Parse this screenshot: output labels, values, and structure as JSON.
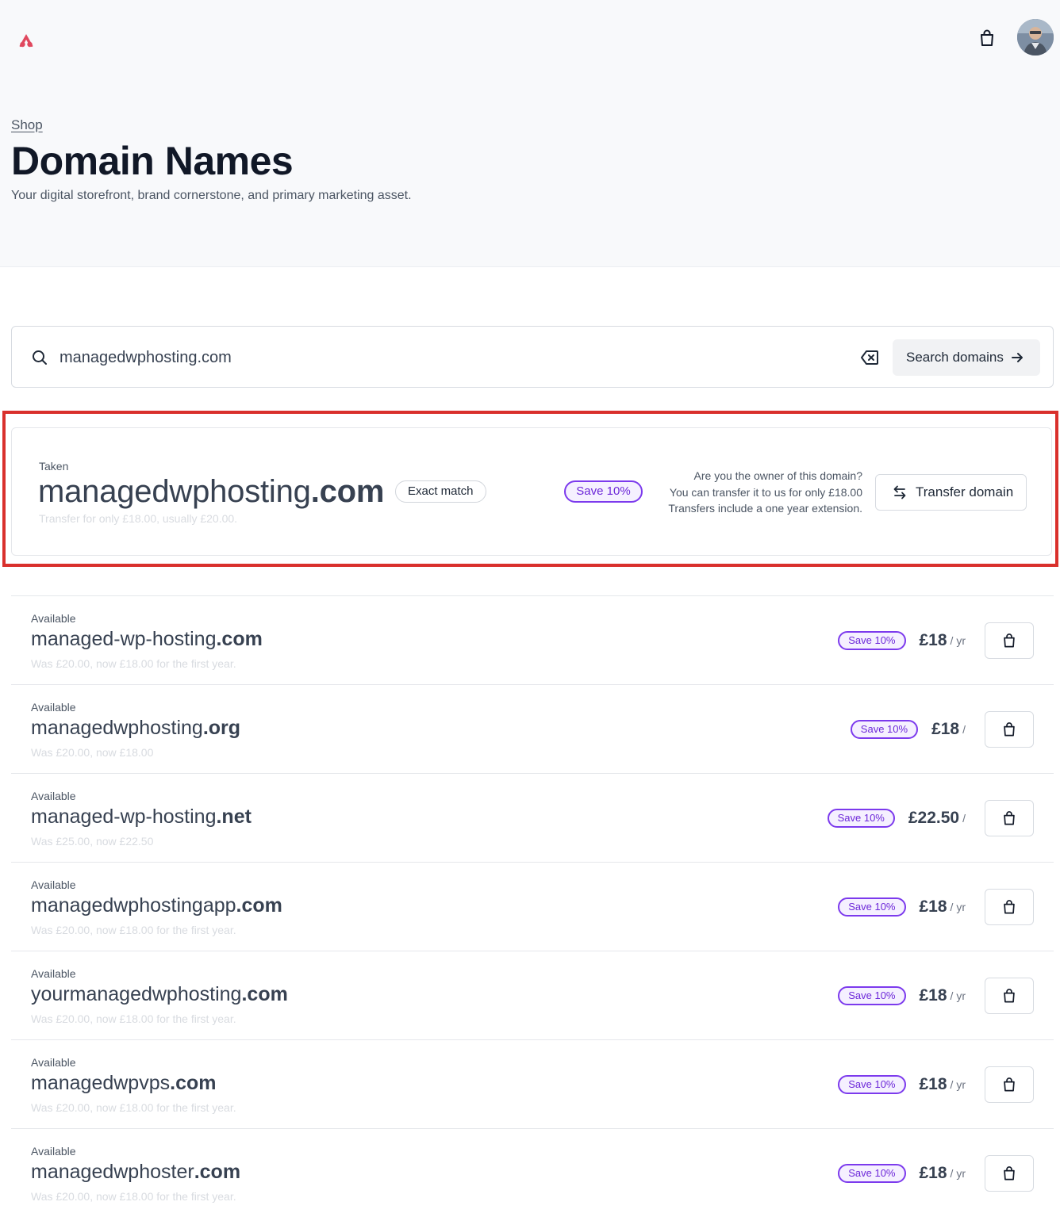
{
  "header": {
    "logo_icon": "brand-logo-icon",
    "cart_icon": "shopping-bag-icon",
    "avatar_alt": "user-avatar"
  },
  "page": {
    "breadcrumb": "Shop",
    "title": "Domain Names",
    "subtitle": "Your digital storefront, brand cornerstone, and primary marketing asset."
  },
  "search": {
    "value": "managedwphosting.com",
    "button_label": "Search domains"
  },
  "exact": {
    "status": "Taken",
    "name": "managedwphosting",
    "tld": ".com",
    "match_badge": "Exact match",
    "note": "Transfer for only £18.00, usually £20.00.",
    "save_badge": "Save 10%",
    "info_line1": "Are you the owner of this domain?",
    "info_line2": "You can transfer it to us for only £18.00",
    "info_line3": "Transfers include a one year extension.",
    "transfer_button": "Transfer domain"
  },
  "results": [
    {
      "status": "Available",
      "name": "managed-wp-hosting",
      "tld": ".com",
      "note": "Was £20.00, now £18.00 for the first year.",
      "save": "Save 10%",
      "price": "£18",
      "per": "/ yr"
    },
    {
      "status": "Available",
      "name": "managedwphosting",
      "tld": ".org",
      "note": "Was £20.00, now £18.00",
      "save": "Save 10%",
      "price": "£18",
      "per": "/"
    },
    {
      "status": "Available",
      "name": "managed-wp-hosting",
      "tld": ".net",
      "note": "Was £25.00, now £22.50",
      "save": "Save 10%",
      "price": "£22.50",
      "per": "/"
    },
    {
      "status": "Available",
      "name": "managedwphostingapp",
      "tld": ".com",
      "note": "Was £20.00, now £18.00 for the first year.",
      "save": "Save 10%",
      "price": "£18",
      "per": "/ yr"
    },
    {
      "status": "Available",
      "name": "yourmanagedwphosting",
      "tld": ".com",
      "note": "Was £20.00, now £18.00 for the first year.",
      "save": "Save 10%",
      "price": "£18",
      "per": "/ yr"
    },
    {
      "status": "Available",
      "name": "managedwpvps",
      "tld": ".com",
      "note": "Was £20.00, now £18.00 for the first year.",
      "save": "Save 10%",
      "price": "£18",
      "per": "/ yr"
    },
    {
      "status": "Available",
      "name": "managedwphoster",
      "tld": ".com",
      "note": "Was £20.00, now £18.00 for the first year.",
      "save": "Save 10%",
      "price": "£18",
      "per": "/ yr"
    }
  ],
  "colors": {
    "accent_purple": "#7c3aed",
    "highlight_red": "#d9302c",
    "logo_red": "#e0485e"
  }
}
